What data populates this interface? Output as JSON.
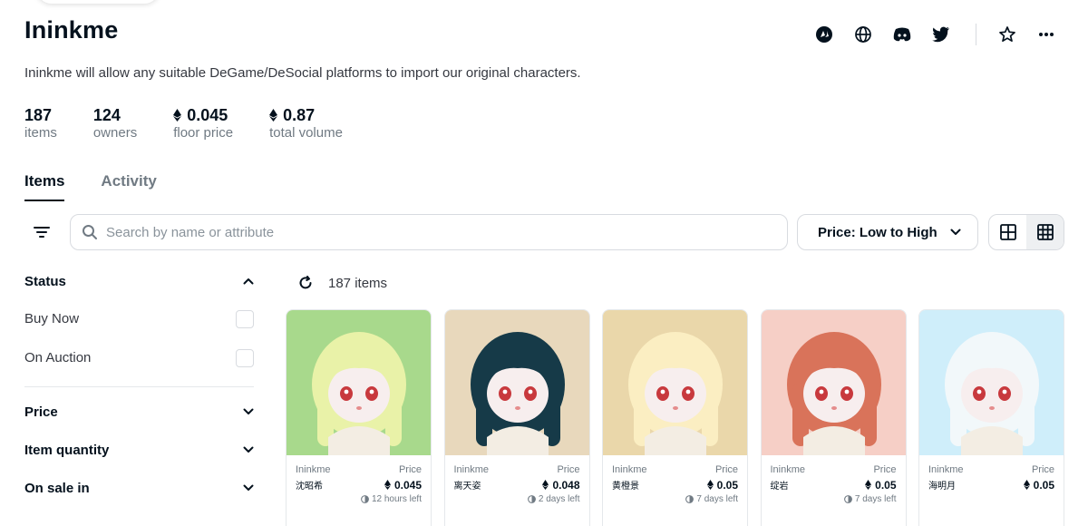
{
  "collection": {
    "title": "Ininkme",
    "description": "Ininkme will allow any suitable DeGame/DeSocial platforms to import our original characters."
  },
  "social_icons": [
    "opensea-like-icon",
    "globe-icon",
    "discord-icon",
    "twitter-icon",
    "star-icon",
    "more-icon"
  ],
  "stats": [
    {
      "value": "187",
      "label": "items",
      "eth": false
    },
    {
      "value": "124",
      "label": "owners",
      "eth": false
    },
    {
      "value": "0.045",
      "label": "floor price",
      "eth": true
    },
    {
      "value": "0.87",
      "label": "total volume",
      "eth": true
    }
  ],
  "tabs": [
    {
      "label": "Items",
      "active": true
    },
    {
      "label": "Activity",
      "active": false
    }
  ],
  "search": {
    "placeholder": "Search by name or attribute",
    "value": ""
  },
  "sort": {
    "label": "Price: Low to High"
  },
  "sidebar": {
    "status": {
      "title": "Status",
      "options": [
        "Buy Now",
        "On Auction"
      ]
    },
    "sections": [
      "Price",
      "Item quantity",
      "On sale in"
    ]
  },
  "results": {
    "count_label": "187 items"
  },
  "cards": [
    {
      "collection": "Ininkme",
      "name": "沈昭希",
      "price_label": "Price",
      "price": "0.045",
      "time": "12 hours left",
      "bg": "#a8d98c"
    },
    {
      "collection": "Ininkme",
      "name": "离天姿",
      "price_label": "Price",
      "price": "0.048",
      "time": "2 days left",
      "bg": "#e8d8bc"
    },
    {
      "collection": "Ininkme",
      "name": "黄橙景",
      "price_label": "Price",
      "price": "0.05",
      "time": "7 days left",
      "bg": "#ead7aa"
    },
    {
      "collection": "Ininkme",
      "name": "绽岩",
      "price_label": "Price",
      "price": "0.05",
      "time": "7 days left",
      "bg": "#f6cfc6"
    },
    {
      "collection": "Ininkme",
      "name": "海明月",
      "price_label": "Price",
      "price": "0.05",
      "time": "",
      "bg": "#cfeefa"
    }
  ]
}
